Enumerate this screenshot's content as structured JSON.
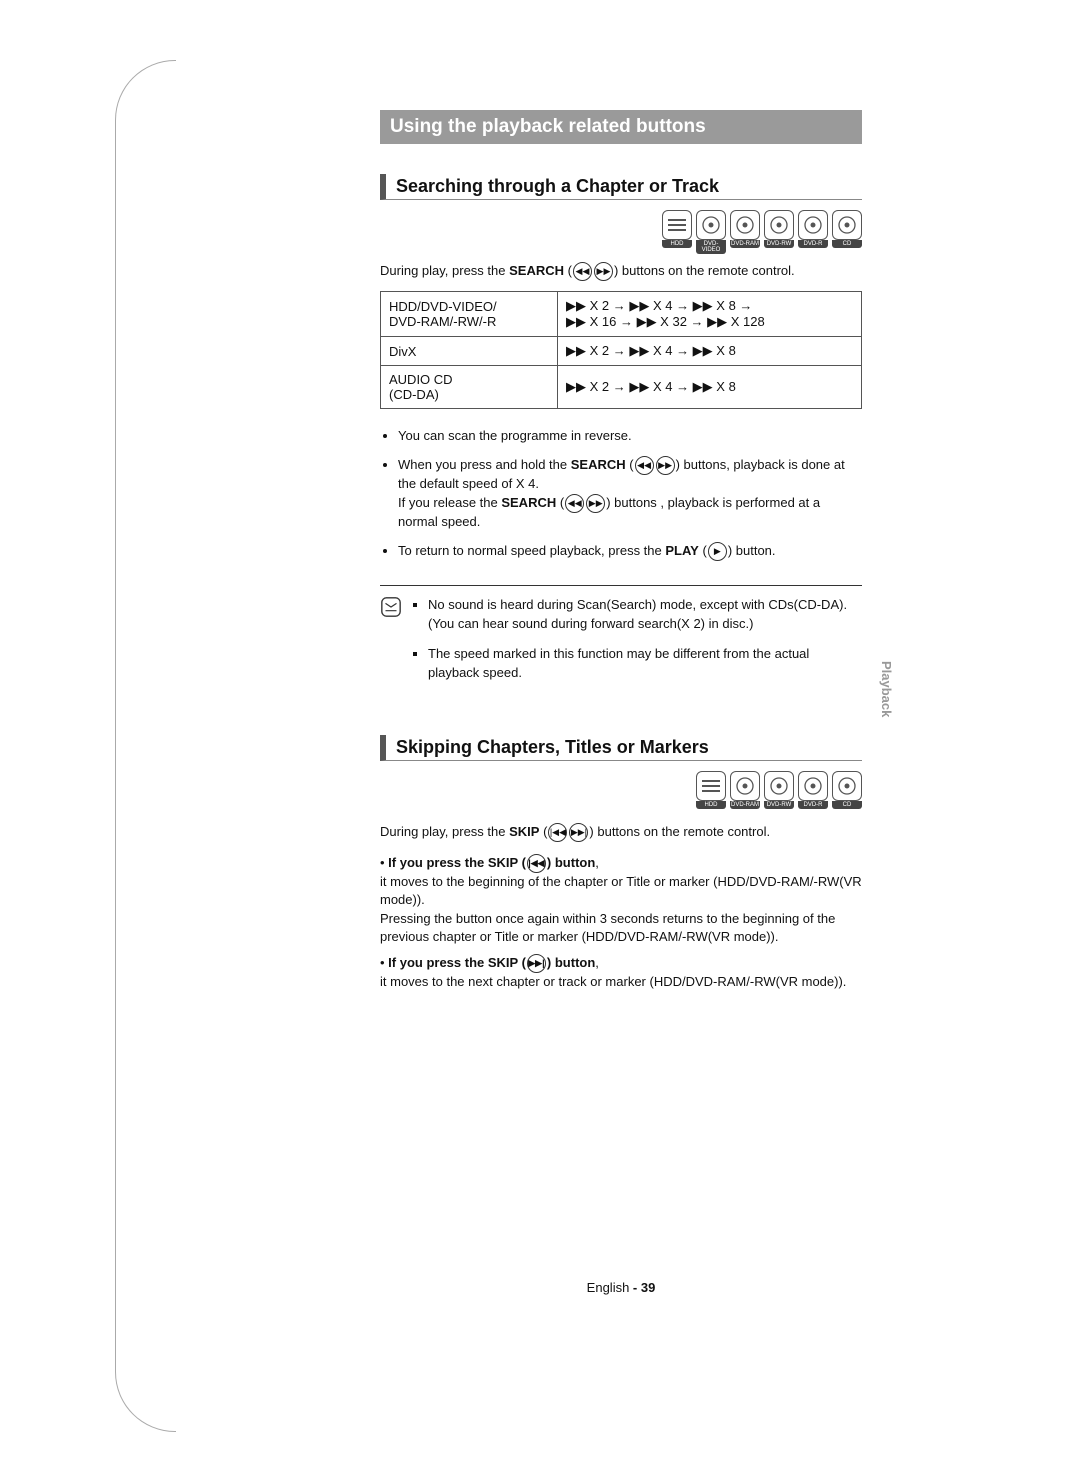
{
  "headerBar": "Using the playback related buttons",
  "section1": {
    "title": "Searching through a Chapter or Track",
    "discs": [
      "HDD",
      "DVD-VIDEO",
      "DVD-RAM",
      "DVD-RW",
      "DVD-R",
      "CD"
    ],
    "intro_pre": "During play, press the ",
    "intro_bold": "SEARCH",
    "intro_post": " buttons on the remote control.",
    "table": [
      {
        "left": "HDD/DVD-VIDEO/\nDVD-RAM/-RW/-R",
        "right": "▶▶ X 2 → ▶▶ X 4 → ▶▶ X 8 →\n▶▶ X 16 → ▶▶ X 32 → ▶▶ X 128"
      },
      {
        "left": "DivX",
        "right": "▶▶ X 2 → ▶▶ X 4 → ▶▶ X 8"
      },
      {
        "left": "AUDIO CD\n(CD-DA)",
        "right": "▶▶ X 2 → ▶▶ X 4 → ▶▶ X 8"
      }
    ],
    "bullets": {
      "b1": "You can scan the programme in reverse.",
      "b2a": "When you press and hold the ",
      "b2b": "SEARCH",
      "b2c": " buttons, playback is done at the default speed of X 4.",
      "b2d": "If you release the ",
      "b2e": "SEARCH",
      "b2f": " buttons , playback is performed at a normal speed.",
      "b3a": "To return to normal speed playback, press the ",
      "b3b": "PLAY",
      "b3c": " button."
    },
    "notes": {
      "n1": "No sound is heard during Scan(Search) mode, except with CDs(CD-DA).",
      "n1b": "(You can hear sound during forward search(X 2) in disc.)",
      "n2": "The speed marked in this function may be different from the actual playback speed."
    }
  },
  "section2": {
    "title": "Skipping Chapters, Titles or Markers",
    "discs": [
      "HDD",
      "DVD-RAM",
      "DVD-RW",
      "DVD-R",
      "CD"
    ],
    "intro_pre": "During play, press the ",
    "intro_bold": "SKIP",
    "intro_post": " buttons on the remote control.",
    "skipBack": {
      "head_a": "If you press the SKIP (",
      "head_b": ") button",
      "body": "it moves to the beginning of the chapter or Title or marker (HDD/DVD-RAM/-RW(VR mode)).\nPressing the button once again within 3 seconds returns to the beginning of the previous chapter or Title or marker (HDD/DVD-RAM/-RW(VR mode))."
    },
    "skipFwd": {
      "head_a": "If you press the SKIP (",
      "head_b": ") button",
      "body": "it moves to the next chapter or track or marker (HDD/DVD-RAM/-RW(VR mode))."
    }
  },
  "sideTab": "Playback",
  "footer_lang": "English",
  "footer_page": " - 39"
}
